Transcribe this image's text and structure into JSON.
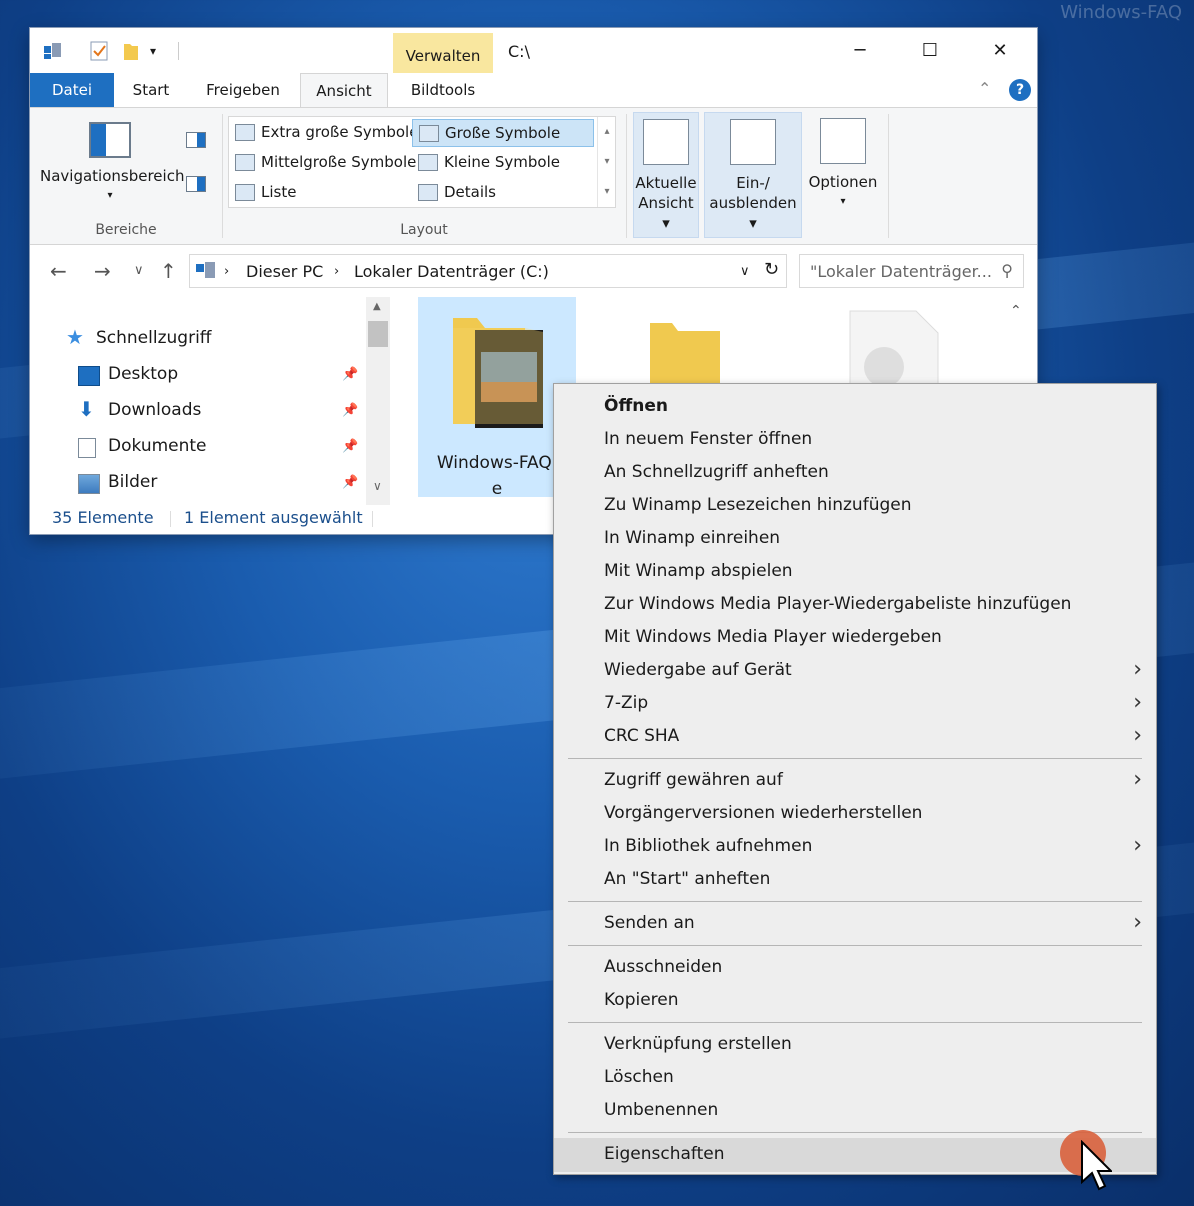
{
  "desktop": {
    "watermark": "Windows-FAQ"
  },
  "window": {
    "title": "C:\\",
    "context_tab": "Verwalten",
    "quick_access": [
      "properties-icon",
      "checkmark-icon",
      "folder-icon",
      "dropdown-icon"
    ],
    "controls": {
      "minimize": "─",
      "maximize": "☐",
      "close": "✕"
    },
    "tabs": [
      {
        "label": "Datei"
      },
      {
        "label": "Start"
      },
      {
        "label": "Freigeben"
      },
      {
        "label": "Ansicht"
      },
      {
        "label": "Bildtools"
      }
    ],
    "ribbon": {
      "bereiche": {
        "nav_button": "Navigationsbereich",
        "group_label": "Bereiche"
      },
      "layout": {
        "items": [
          "Extra große Symbole",
          "Große Symbole",
          "Mittelgroße Symbole",
          "Kleine Symbole",
          "Liste",
          "Details"
        ],
        "selected": "Große Symbole",
        "group_label": "Layout"
      },
      "current_view": {
        "line1": "Aktuelle",
        "line2": "Ansicht"
      },
      "show_hide": {
        "line1": "Ein-/",
        "line2": "ausblenden"
      },
      "options": "Optionen"
    },
    "address": {
      "crumbs": [
        "Dieser PC",
        "Lokaler Datenträger (C:)"
      ],
      "search_placeholder": "\"Lokaler Datenträger..."
    },
    "nav": {
      "items": [
        {
          "label": "Schnellzugriff"
        },
        {
          "label": "Desktop"
        },
        {
          "label": "Downloads"
        },
        {
          "label": "Dokumente"
        },
        {
          "label": "Bilder"
        }
      ]
    },
    "content": {
      "selected_folder_line1": "Windows-FAQ.",
      "selected_folder_line2": "e"
    },
    "status": {
      "count": "35 Elemente",
      "selected": "1 Element ausgewählt"
    }
  },
  "context_menu": {
    "items": [
      {
        "label": "Öffnen"
      },
      {
        "label": "In neuem Fenster öffnen"
      },
      {
        "label": "An Schnellzugriff anheften"
      },
      {
        "label": "Zu Winamp Lesezeichen hinzufügen"
      },
      {
        "label": "In Winamp einreihen"
      },
      {
        "label": "Mit Winamp abspielen"
      },
      {
        "label": "Zur Windows Media Player-Wiedergabeliste hinzufügen"
      },
      {
        "label": "Mit Windows Media Player wiedergeben"
      },
      {
        "label": "Wiedergabe auf Gerät"
      },
      {
        "label": "7-Zip"
      },
      {
        "label": "CRC SHA"
      },
      {
        "label": "Zugriff gewähren auf"
      },
      {
        "label": "Vorgängerversionen wiederherstellen"
      },
      {
        "label": "In Bibliothek aufnehmen"
      },
      {
        "label": "An \"Start\" anheften"
      },
      {
        "label": "Senden an"
      },
      {
        "label": "Ausschneiden"
      },
      {
        "label": "Kopieren"
      },
      {
        "label": "Verknüpfung erstellen"
      },
      {
        "label": "Löschen"
      },
      {
        "label": "Umbenennen"
      },
      {
        "label": "Eigenschaften"
      }
    ],
    "submenu_arrow": "›",
    "hovered": "Eigenschaften"
  },
  "colors": {
    "accent": "#1e6fc1",
    "context_tab": "#f9e79f",
    "selection": "#cce8ff",
    "cursor_highlight": "#d8603c"
  }
}
